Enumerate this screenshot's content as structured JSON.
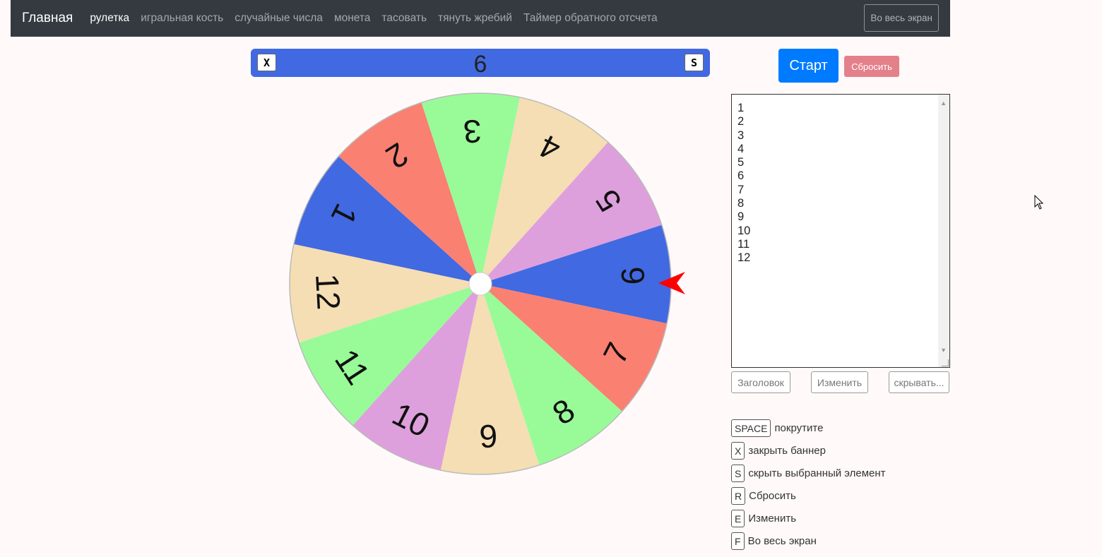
{
  "nav": {
    "brand": "Главная",
    "links": [
      "рулетка",
      "игральная кость",
      "случайные числа",
      "монета",
      "тасовать",
      "тянуть жребий",
      "Таймер обратного отсчета"
    ],
    "fullscreen": "Во весь экран"
  },
  "banner": {
    "close_key": "X",
    "hide_key": "S",
    "value": "6",
    "color": "#4169e1"
  },
  "wheel": {
    "labels": [
      "1",
      "2",
      "3",
      "4",
      "5",
      "6",
      "7",
      "8",
      "9",
      "10",
      "11",
      "12"
    ],
    "colors": [
      "#4169e1",
      "#fa8072",
      "#98fb98",
      "#f5deb3",
      "#dda0dd",
      "#4169e1",
      "#fa8072",
      "#98fb98",
      "#f5deb3",
      "#dda0dd",
      "#98fb98",
      "#f5deb3"
    ],
    "selected": "6",
    "pointer_color": "#ff0000"
  },
  "controls": {
    "start": "Старт",
    "reset": "Сбросить"
  },
  "items_text": "1\n2\n3\n4\n5\n6\n7\n8\n9\n10\n11\n12",
  "buttons": {
    "title": "Заголовок",
    "edit": "Изменить",
    "hide": "скрывать..."
  },
  "shortcuts": [
    {
      "key": "SPACE",
      "label": "покрутите"
    },
    {
      "key": "X",
      "label": "закрыть баннер"
    },
    {
      "key": "S",
      "label": "скрыть выбранный элемент"
    },
    {
      "key": "R",
      "label": "Сбросить"
    },
    {
      "key": "E",
      "label": "Изменить"
    },
    {
      "key": "F",
      "label": "Во весь экран"
    }
  ]
}
